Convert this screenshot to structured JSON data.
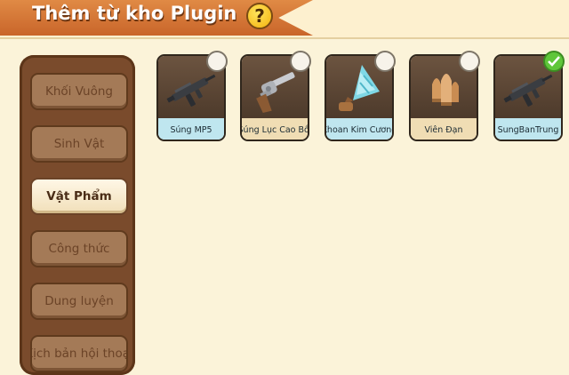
{
  "header": {
    "title": "Thêm từ kho Plugin",
    "help_label": "?"
  },
  "sidebar": {
    "items": [
      {
        "label": "Khối Vuông",
        "active": false
      },
      {
        "label": "Sinh Vật",
        "active": false
      },
      {
        "label": "Vật Phẩm",
        "active": true
      },
      {
        "label": "Công thức",
        "active": false
      },
      {
        "label": "Dung luyện",
        "active": false
      },
      {
        "label": "Kịch bản hội thoại",
        "active": false
      }
    ]
  },
  "items": [
    {
      "label": "Súng MP5",
      "icon": "smg-icon",
      "selected": false
    },
    {
      "label": "Súng Lục Cao Bồi",
      "icon": "revolver-icon",
      "selected": false
    },
    {
      "label": "Khoan Kim Cương",
      "icon": "diamond-drill-icon",
      "selected": false
    },
    {
      "label": "Viên Đạn",
      "icon": "bullets-icon",
      "selected": false
    },
    {
      "label": "SungBanTrung",
      "icon": "smg-icon",
      "selected": true
    }
  ],
  "colors": {
    "background": "#fbf3d9",
    "banner": "#d8773a",
    "sidebar": "#7a4b2c",
    "label_blue": "#bfe6ef",
    "label_tan": "#f0ddb4",
    "check_on": "#5fc63a"
  }
}
